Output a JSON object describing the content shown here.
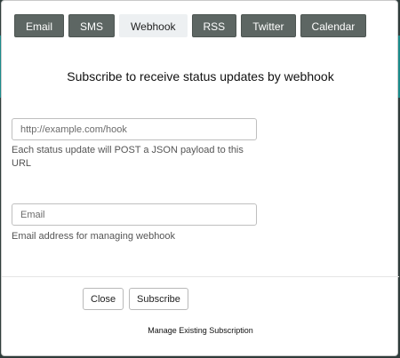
{
  "tabs": [
    {
      "label": "Email",
      "active": false
    },
    {
      "label": "SMS",
      "active": false
    },
    {
      "label": "Webhook",
      "active": true
    },
    {
      "label": "RSS",
      "active": false
    },
    {
      "label": "Twitter",
      "active": false
    },
    {
      "label": "Calendar",
      "active": false
    }
  ],
  "heading": "Subscribe to receive status updates by webhook",
  "webhook": {
    "value": "",
    "placeholder": "http://example.com/hook",
    "help": "Each status update will POST a JSON payload to this URL"
  },
  "email": {
    "value": "",
    "placeholder": "Email",
    "help": "Email address for managing webhook"
  },
  "buttons": {
    "close": "Close",
    "subscribe": "Subscribe"
  },
  "manage_link": "Manage Existing Subscription",
  "colors": {
    "tab_bg": "#5d6663",
    "tab_active_bg": "#edf0f2",
    "backdrop_accent": "#1a8a8a"
  }
}
